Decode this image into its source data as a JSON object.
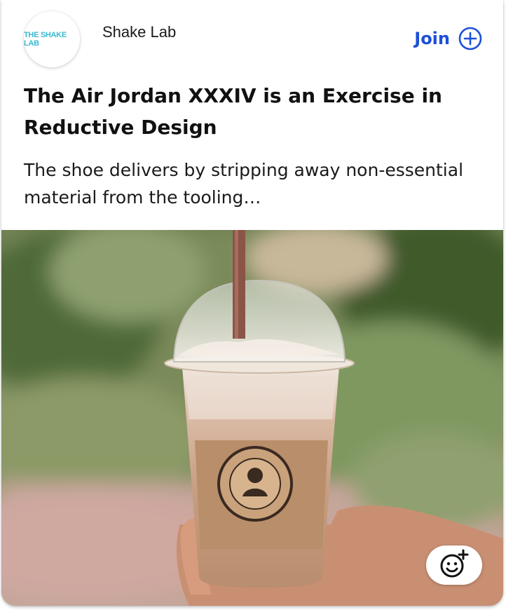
{
  "source": {
    "logo_text": "THE SHAKE LAB",
    "name": "Shake Lab"
  },
  "join": {
    "label": "Join"
  },
  "article": {
    "headline": "The Air Jordan XXXIV is an Exercise in Reductive Design",
    "summary": "The shoe delivers by stripping away non-essential material from the tooling…"
  },
  "image": {
    "alt": "Iced coffee in a plastic cup with a straw, held in a hand outdoors"
  },
  "icons": {
    "join": "plus-circle-icon",
    "reaction": "add-reaction-icon"
  },
  "colors": {
    "accent": "#1d4fd8"
  }
}
